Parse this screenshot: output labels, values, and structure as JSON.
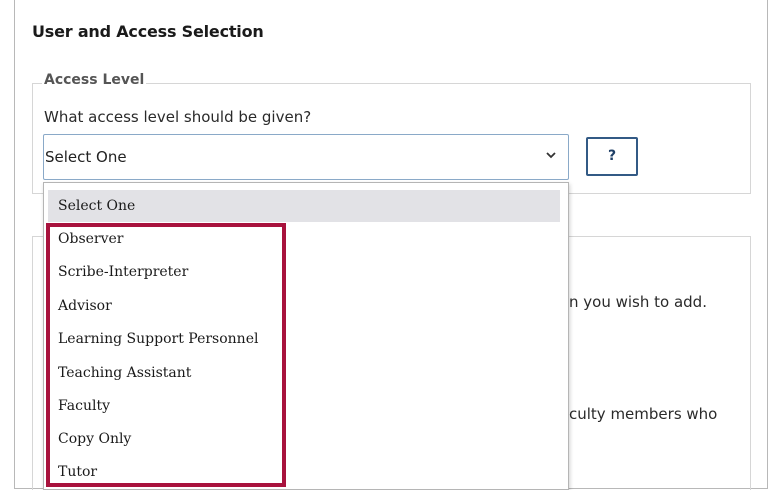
{
  "page": {
    "title": "User and Access Selection"
  },
  "access_level": {
    "legend": "Access Level",
    "question": "What access level should be given?",
    "select_value": "Select One",
    "help_label": "?"
  },
  "background_text": {
    "line1": "n you wish to add.",
    "line2": "culty members who"
  },
  "dropdown": {
    "options": [
      {
        "label": "Select One",
        "selected": true
      },
      {
        "label": "Observer"
      },
      {
        "label": "Scribe-Interpreter"
      },
      {
        "label": "Advisor"
      },
      {
        "label": "Learning Support Personnel"
      },
      {
        "label": "Teaching Assistant"
      },
      {
        "label": "Faculty"
      },
      {
        "label": "Copy Only"
      },
      {
        "label": "Tutor"
      }
    ]
  },
  "colors": {
    "highlight": "#a8123d",
    "help_border": "#335a85",
    "select_border": "#8aa9c8",
    "selected_option_bg": "#e2e2e6"
  },
  "icons": {
    "select_arrow": "chevron-down-icon"
  }
}
